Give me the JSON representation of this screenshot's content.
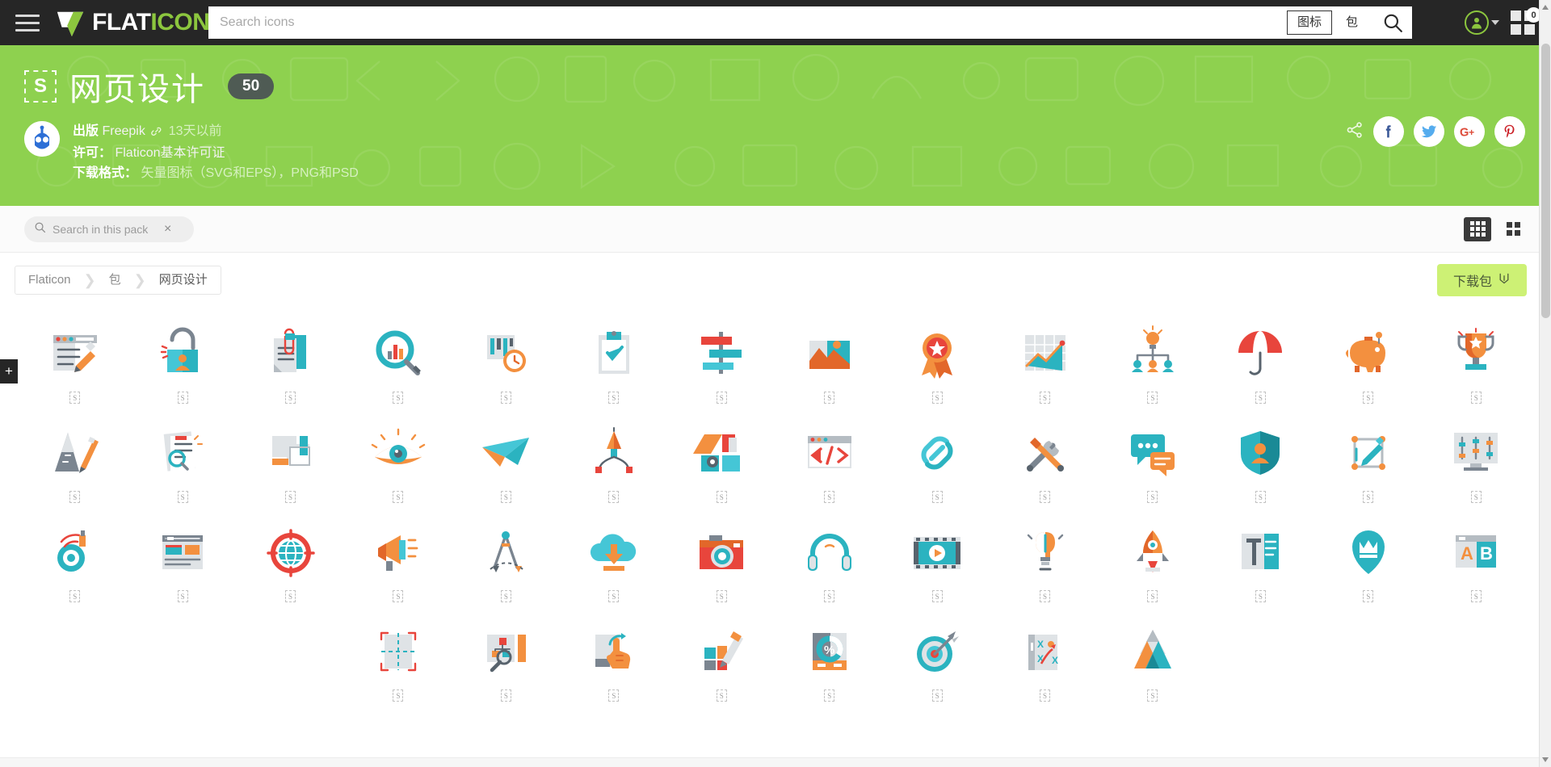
{
  "topnav": {
    "menu_icon": "hamburger-icon",
    "brand_white": "FLAT",
    "brand_green": "ICON",
    "search_placeholder": "Search icons",
    "search_value": "",
    "seg_icons": "图标",
    "seg_packs": "包",
    "search_icon": "search-icon",
    "avatar_icon": "user-avatar-icon",
    "collection_badge": "0",
    "collection_icon": "grid-collections-icon"
  },
  "banner": {
    "pack_badge_letter": "S",
    "pack_title": "网页设计",
    "pack_count": "50",
    "published_label": "出版",
    "published_author": "Freepik",
    "published_ago": "13天以前",
    "license_label": "许可：",
    "license_value": "Flaticon基本许可证",
    "formats_label": "下载格式：",
    "formats_value": "矢量图标（SVG和EPS），PNG和PSD",
    "social": [
      {
        "name": "share-icon",
        "label": "Share"
      },
      {
        "name": "facebook-icon",
        "label": "f"
      },
      {
        "name": "twitter-icon",
        "label": "Twitter"
      },
      {
        "name": "google-plus-icon",
        "label": "G+"
      },
      {
        "name": "pinterest-icon",
        "label": "P"
      }
    ],
    "accent_green": "#8ed14f",
    "count_bg": "#4f5b54"
  },
  "subbar": {
    "pack_search_placeholder": "Search in this pack",
    "pack_search_value": "",
    "pack_search_icon": "search-icon",
    "clear_icon": "×",
    "view_small_icon": "grid-small-view-icon",
    "view_large_icon": "grid-large-view-icon",
    "active_view": "small"
  },
  "crumbrow": {
    "breadcrumb": [
      "Flaticon",
      "包",
      "网页设计"
    ],
    "download_label": "下载包",
    "download_icon": "download-icon",
    "download_bg": "#cdf175"
  },
  "grid": {
    "add_tab_label": "+",
    "badge_letter": "S",
    "columns": 14,
    "icons": [
      {
        "name": "web-design-browser-pencil-icon"
      },
      {
        "name": "security-lock-user-icon"
      },
      {
        "name": "document-clip-icon"
      },
      {
        "name": "search-analytics-icon"
      },
      {
        "name": "project-timeline-clock-icon"
      },
      {
        "name": "checklist-clipboard-icon"
      },
      {
        "name": "sitemap-signpost-icon"
      },
      {
        "name": "image-gallery-icon"
      },
      {
        "name": "award-badge-icon"
      },
      {
        "name": "growth-chart-icon"
      },
      {
        "name": "team-idea-hierarchy-icon"
      },
      {
        "name": "umbrella-protection-icon"
      },
      {
        "name": "piggy-bank-savings-icon"
      },
      {
        "name": "trophy-award-icon"
      },
      {
        "name": "drawing-tools-ruler-icon"
      },
      {
        "name": "document-review-search-icon"
      },
      {
        "name": "layers-arrange-icon"
      },
      {
        "name": "eye-vision-icon"
      },
      {
        "name": "paper-plane-send-icon"
      },
      {
        "name": "bezier-pen-tool-icon"
      },
      {
        "name": "color-swatch-palette-icon"
      },
      {
        "name": "code-window-icon"
      },
      {
        "name": "link-chain-icon"
      },
      {
        "name": "tools-wrench-screwdriver-icon"
      },
      {
        "name": "chat-bubbles-icon"
      },
      {
        "name": "shield-user-protection-icon"
      },
      {
        "name": "crop-edit-icon"
      },
      {
        "name": "settings-sliders-monitor-icon"
      },
      {
        "name": "spray-paint-icon"
      },
      {
        "name": "wireframe-layout-icon"
      },
      {
        "name": "globe-target-icon"
      },
      {
        "name": "megaphone-marketing-icon"
      },
      {
        "name": "compass-geometry-icon"
      },
      {
        "name": "cloud-upload-icon"
      },
      {
        "name": "camera-photo-icon"
      },
      {
        "name": "headphones-audio-icon"
      },
      {
        "name": "video-film-play-icon"
      },
      {
        "name": "idea-bulb-pen-icon"
      },
      {
        "name": "rocket-launch-icon"
      },
      {
        "name": "typography-text-icon"
      },
      {
        "name": "location-pin-crown-icon"
      },
      {
        "name": "ab-testing-icon"
      },
      {
        "name": "artboard-crop-marks-icon"
      },
      {
        "name": "sitemap-magnifier-icon"
      },
      {
        "name": "touch-gesture-icon"
      },
      {
        "name": "design-tools-brush-icon"
      },
      {
        "name": "mobile-analytics-percent-icon"
      },
      {
        "name": "target-dart-icon"
      },
      {
        "name": "strategy-plan-icon"
      },
      {
        "name": "triangle-shapes-icon"
      }
    ]
  }
}
